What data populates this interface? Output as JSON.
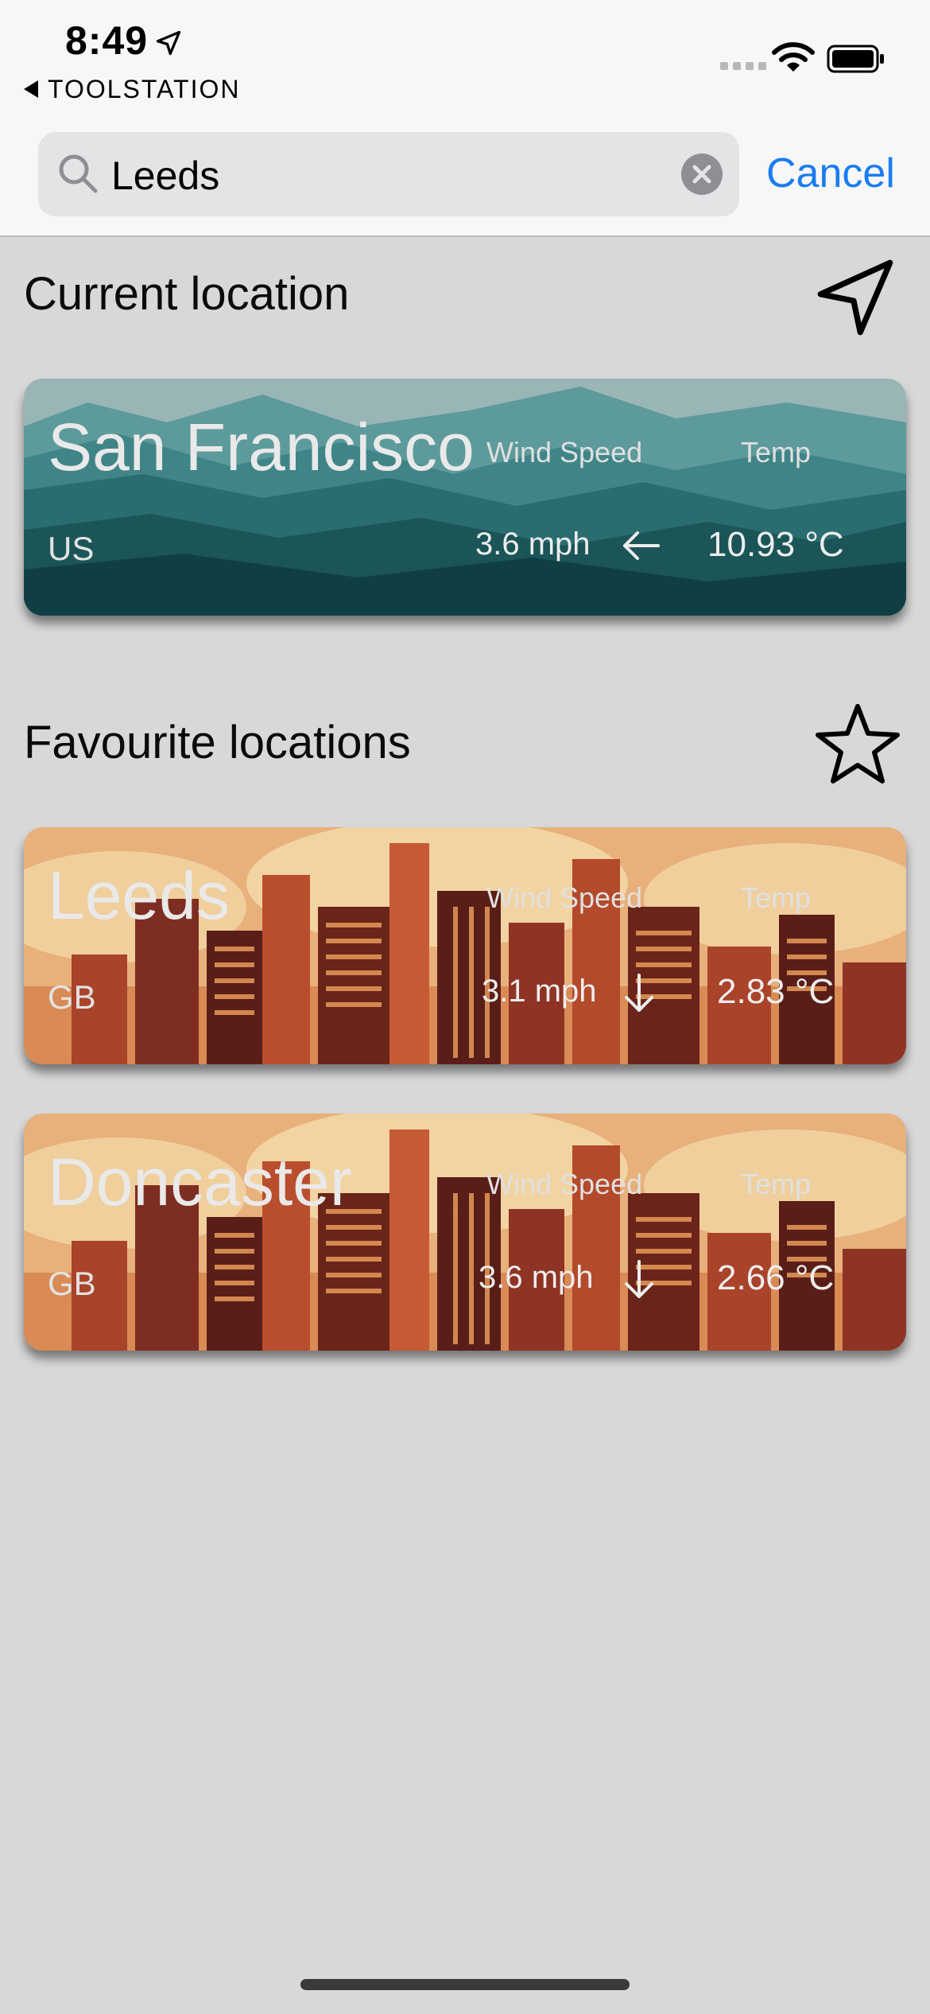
{
  "status_bar": {
    "time": "8:49",
    "back_app": "TOOLSTATION"
  },
  "search": {
    "value": "Leeds",
    "cancel_label": "Cancel"
  },
  "sections": {
    "current": "Current location",
    "favourites": "Favourite locations"
  },
  "current_location": {
    "city": "San Francisco",
    "country": "US",
    "wind_label": "Wind Speed",
    "wind_value": "3.6 mph",
    "wind_direction": "left",
    "temp_label": "Temp",
    "temp_value": "10.93 °C"
  },
  "favourites": [
    {
      "city": "Leeds",
      "country": "GB",
      "wind_label": "Wind Speed",
      "wind_value": "3.1 mph",
      "wind_direction": "down",
      "temp_label": "Temp",
      "temp_value": "2.83 °C"
    },
    {
      "city": "Doncaster",
      "country": "GB",
      "wind_label": "Wind Speed",
      "wind_value": "3.6 mph",
      "wind_direction": "down",
      "temp_label": "Temp",
      "temp_value": "2.66 °C"
    }
  ],
  "icons": {
    "location": "location-arrow-icon",
    "search": "search-icon",
    "clear": "clear-icon",
    "navigation": "navigation-arrow-icon",
    "favourite": "star-icon"
  },
  "colors": {
    "accent": "#1a7cf0",
    "background": "#d8d8d8",
    "mountain": "#2f7a7c",
    "city": "#c25a34"
  }
}
